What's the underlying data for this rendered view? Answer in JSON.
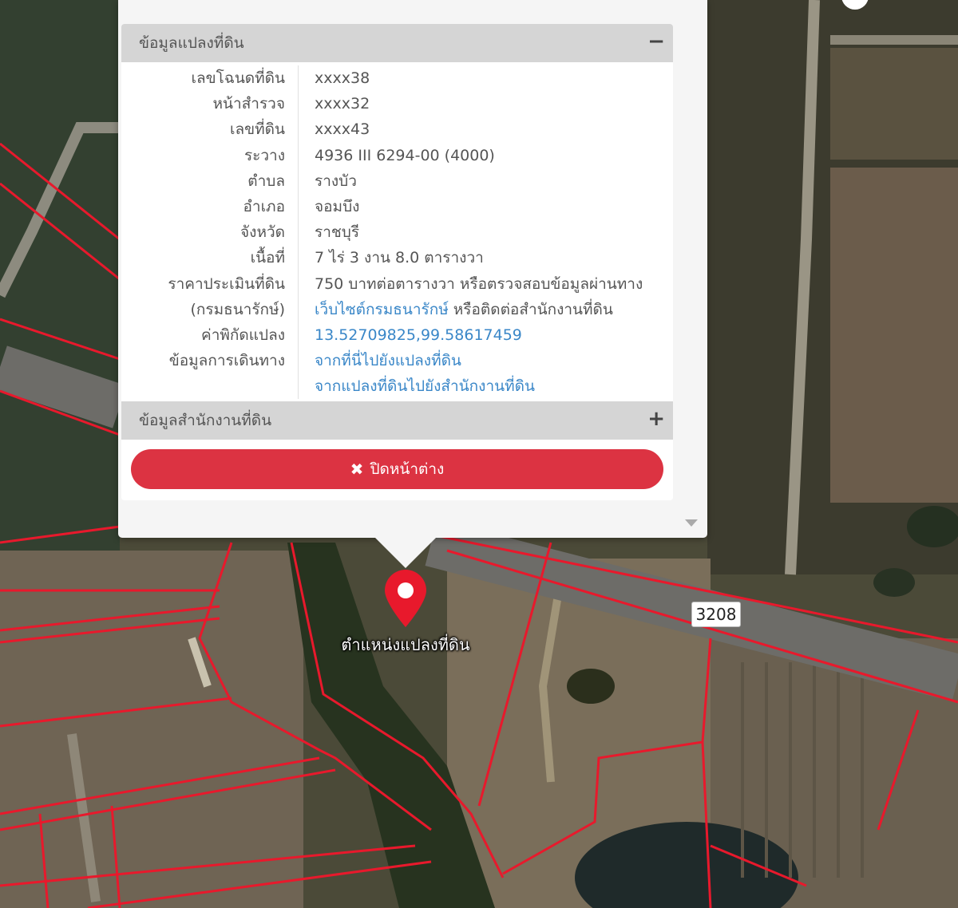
{
  "popup": {
    "section_title": "ข้อมูลแปลงที่ดิน",
    "collapse_icon": "minus-icon",
    "rows": [
      {
        "label": "เลขโฉนดที่ดิน",
        "value": "xxxx38"
      },
      {
        "label": "หน้าสำรวจ",
        "value": "xxxx32"
      },
      {
        "label": "เลขที่ดิน",
        "value": "xxxx43"
      },
      {
        "label": "ระวาง",
        "value": "4936 III 6294-00 (4000)"
      },
      {
        "label": "ตำบล",
        "value": "รางบัว"
      },
      {
        "label": "อำเภอ",
        "value": "จอมบึง"
      },
      {
        "label": "จังหวัด",
        "value": "ราชบุรี"
      },
      {
        "label": "เนื้อที่",
        "value": "7 ไร่ 3 งาน 8.0 ตารางวา"
      }
    ],
    "price": {
      "label_line1": "ราคาประเมินที่ดิน",
      "label_line2": "(กรมธนารักษ์)",
      "value_line1": "750 บาทต่อตารางวา หรือตรวจสอบข้อมูลผ่านทาง",
      "link": "เว็บไซต์กรมธนารักษ์",
      "value_line2_rest": " หรือติดต่อสำนักงานที่ดิน"
    },
    "coords": {
      "label": "ค่าพิกัดแปลง",
      "value": "13.52709825,99.58617459"
    },
    "travel": {
      "label": "ข้อมูลการเดินทาง",
      "link1": "จากที่นี่ไปยังแปลงที่ดิน",
      "link2": "จากแปลงที่ดินไปยังสำนักงานที่ดิน"
    },
    "office_section_title": "ข้อมูลสำนักงานที่ดิน",
    "expand_icon": "plus-icon",
    "close_label": "ปิดหน้าต่าง"
  },
  "map": {
    "marker_label": "ตำแหน่งแปลงที่ดิน",
    "road_number": "3208",
    "marker_color": "#e8192c",
    "parcel_line_color": "#e8192c"
  }
}
